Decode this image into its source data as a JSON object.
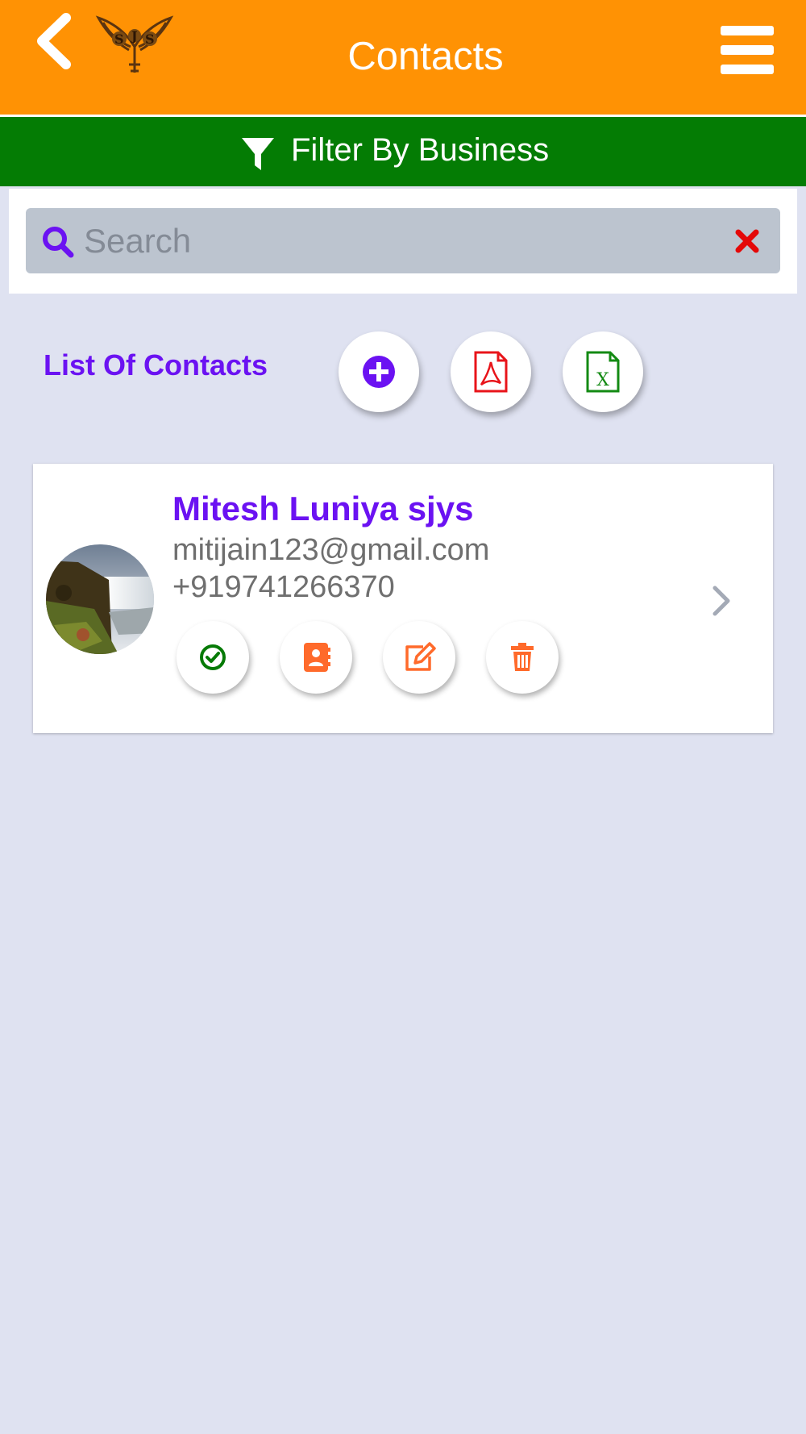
{
  "header": {
    "title": "Contacts",
    "back_icon": "chevron-left-icon",
    "menu_icon": "hamburger-menu-icon",
    "logo": "SJS"
  },
  "filter": {
    "label": "Filter By Business",
    "icon": "filter-icon"
  },
  "search": {
    "placeholder": "Search",
    "value": "",
    "icon": "search-icon",
    "clear_icon": "close-icon"
  },
  "list": {
    "title": "List Of Contacts",
    "actions": [
      {
        "name": "add-contact",
        "icon": "plus-circle-icon",
        "color": "#6b12f2"
      },
      {
        "name": "export-pdf",
        "icon": "pdf-file-icon",
        "color": "#e8141a"
      },
      {
        "name": "export-excel",
        "icon": "excel-file-icon",
        "color": "#138a13"
      }
    ]
  },
  "contacts": [
    {
      "name": "Mitesh Luniya sjys",
      "email": "mitijain123@gmail.com",
      "phone": "+919741266370",
      "actions": [
        {
          "name": "verify",
          "icon": "check-circle-icon",
          "color": "#067a06"
        },
        {
          "name": "address-book",
          "icon": "address-book-icon",
          "color": "#ff6a2b"
        },
        {
          "name": "edit",
          "icon": "edit-icon",
          "color": "#ff6a2b"
        },
        {
          "name": "delete",
          "icon": "trash-icon",
          "color": "#ff6a2b"
        }
      ]
    }
  ],
  "colors": {
    "header_bg": "#ff9204",
    "filter_bg": "#047c04",
    "accent": "#6b12f2",
    "page_bg": "#dfe2f1"
  }
}
